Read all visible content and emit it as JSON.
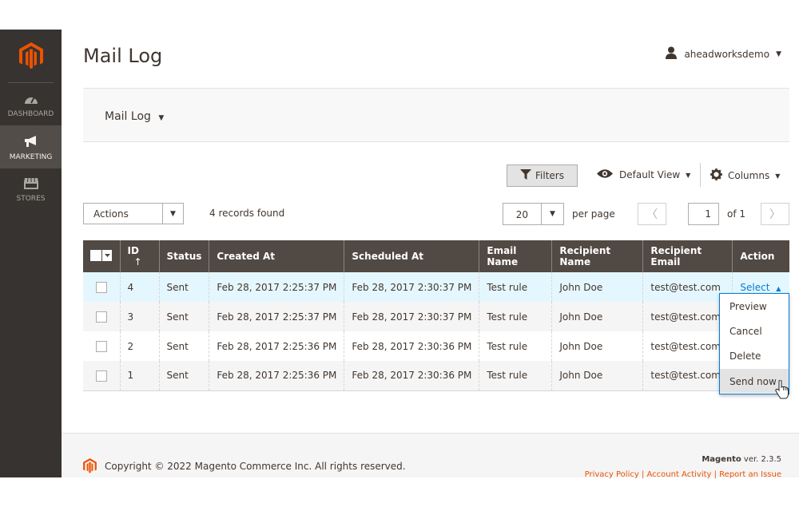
{
  "sidebar": {
    "logo": "magento-logo",
    "items": [
      {
        "label": "DASHBOARD",
        "icon": "dashboard-icon",
        "active": false
      },
      {
        "label": "MARKETING",
        "icon": "megaphone-icon",
        "active": true
      },
      {
        "label": "STORES",
        "icon": "store-icon",
        "active": false
      }
    ]
  },
  "header": {
    "title": "Mail Log",
    "user": "aheadworksdemo"
  },
  "switcher": {
    "label": "Mail Log"
  },
  "grid_controls": {
    "filters_label": "Filters",
    "view_label": "Default View",
    "columns_label": "Columns",
    "actions_label": "Actions",
    "records_found": "4 records found",
    "page_size": "20",
    "per_page": "per page",
    "current_page": "1",
    "of_pages": "of 1"
  },
  "table": {
    "columns": [
      "ID",
      "Status",
      "Created At",
      "Scheduled At",
      "Email Name",
      "Recipient Name",
      "Recipient Email",
      "Action"
    ],
    "sort_indicator": "↑",
    "rows": [
      {
        "id": "4",
        "status": "Sent",
        "created": "Feb 28, 2017 2:25:37 PM",
        "scheduled": "Feb 28, 2017 2:30:37 PM",
        "email_name": "Test rule",
        "recipient_name": "John Doe",
        "recipient_email": "test@test.com",
        "action": "Select"
      },
      {
        "id": "3",
        "status": "Sent",
        "created": "Feb 28, 2017 2:25:37 PM",
        "scheduled": "Feb 28, 2017 2:30:37 PM",
        "email_name": "Test rule",
        "recipient_name": "John Doe",
        "recipient_email": "test@test.com",
        "action": ""
      },
      {
        "id": "2",
        "status": "Sent",
        "created": "Feb 28, 2017 2:25:36 PM",
        "scheduled": "Feb 28, 2017 2:30:36 PM",
        "email_name": "Test rule",
        "recipient_name": "John Doe",
        "recipient_email": "test@test.com",
        "action": ""
      },
      {
        "id": "1",
        "status": "Sent",
        "created": "Feb 28, 2017 2:25:36 PM",
        "scheduled": "Feb 28, 2017 2:30:36 PM",
        "email_name": "Test rule",
        "recipient_name": "John Doe",
        "recipient_email": "test@test.com",
        "action": ""
      }
    ]
  },
  "action_menu": {
    "items": [
      "Preview",
      "Cancel",
      "Delete",
      "Send now"
    ],
    "hovered": "Send now"
  },
  "footer": {
    "copyright": "Copyright © 2022 Magento Commerce Inc. All rights reserved.",
    "brand": "Magento",
    "version": "ver. 2.3.5",
    "links": "Privacy Policy | Account Activity | Report an Issue"
  },
  "colors": {
    "sidebar_bg": "#373330",
    "header_row_bg": "#514943",
    "link": "#007bdb",
    "accent": "#eb5202"
  }
}
